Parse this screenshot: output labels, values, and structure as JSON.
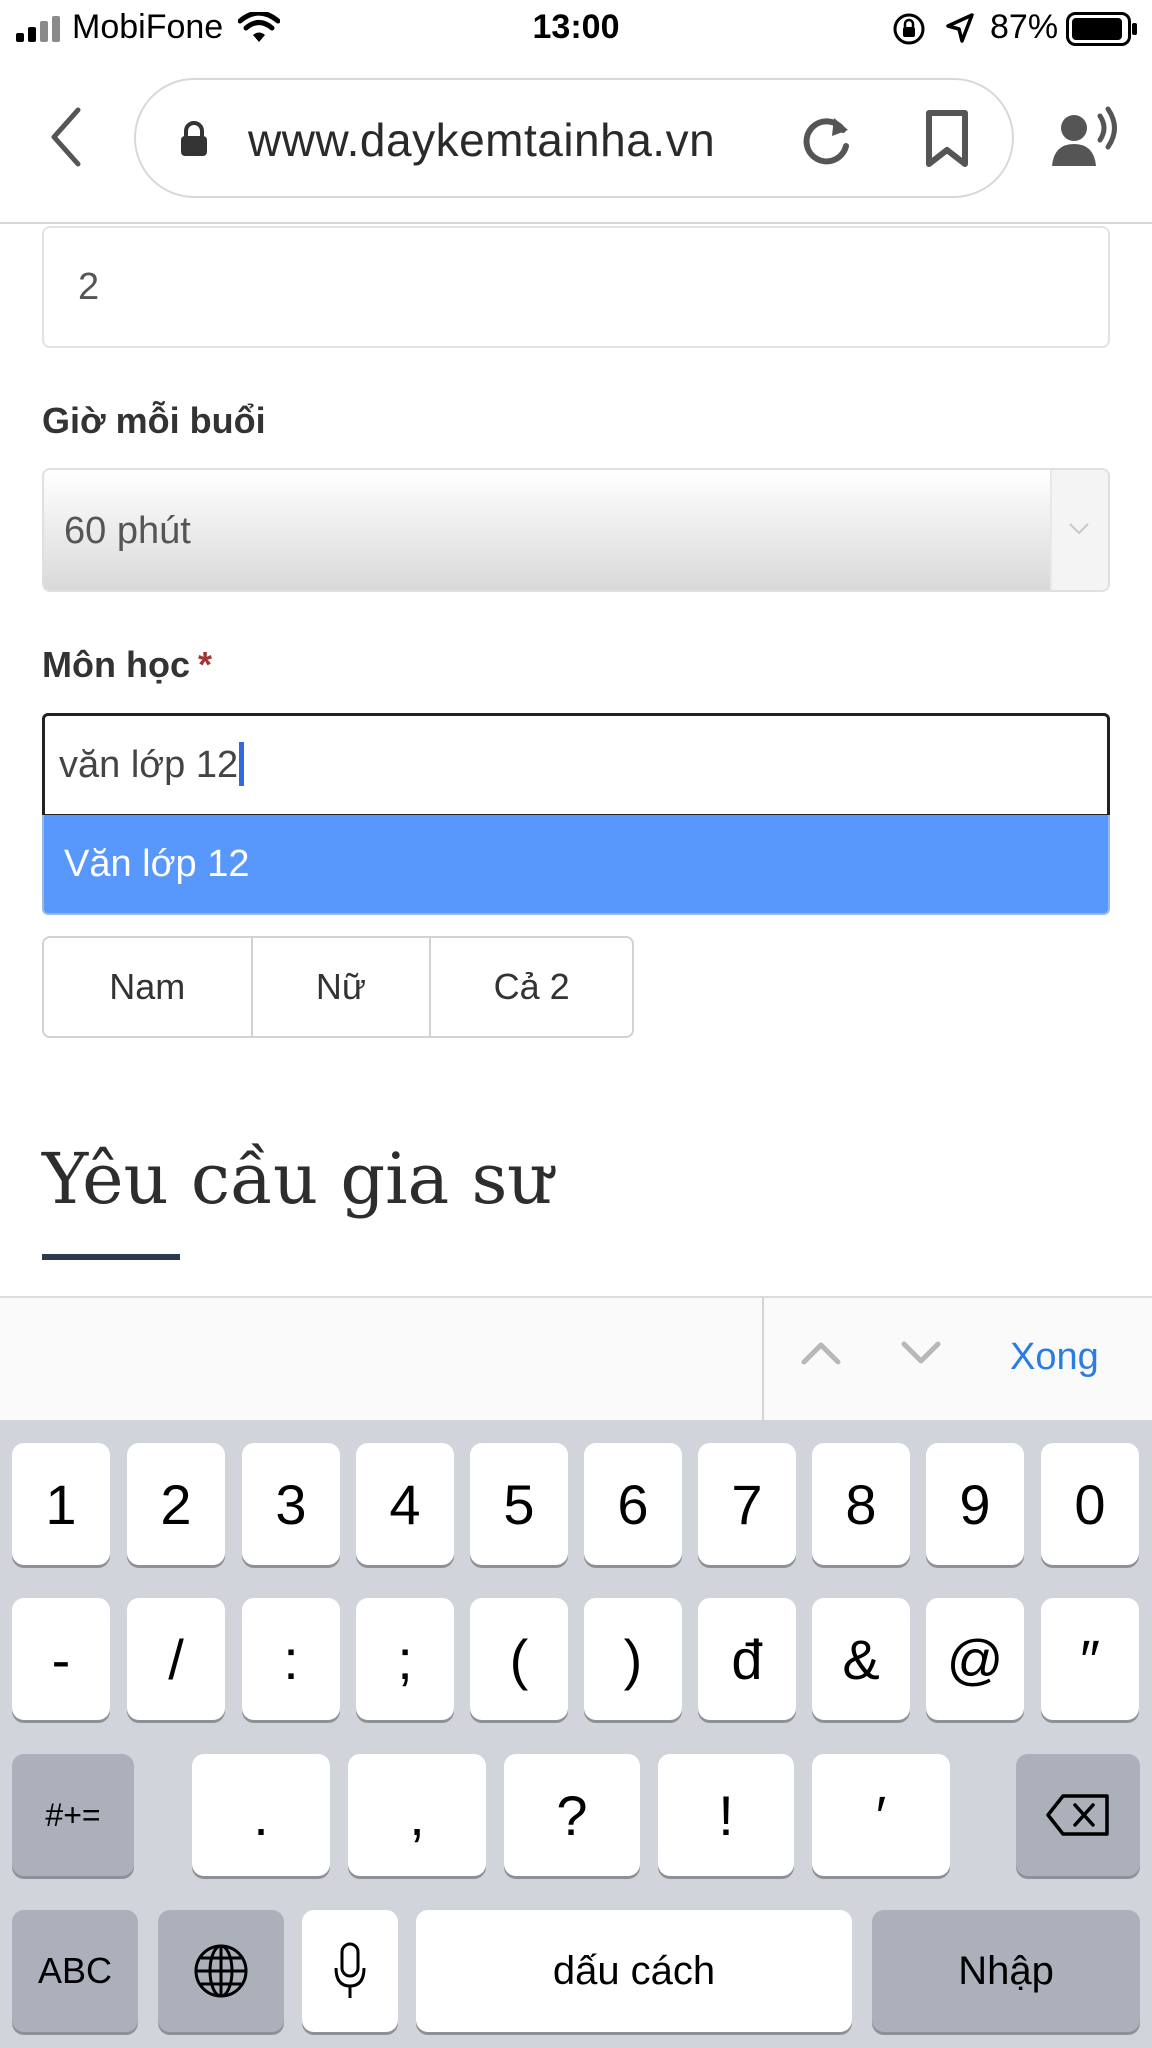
{
  "status_bar": {
    "carrier": "MobiFone",
    "time": "13:00",
    "battery_percent": "87%",
    "icons": [
      "signal-icon",
      "wifi-icon",
      "orientation-lock-icon",
      "location-icon",
      "battery-icon"
    ]
  },
  "browser": {
    "url": "www.daykemtainha.vn",
    "icons": [
      "back-icon",
      "lock-icon",
      "reload-icon",
      "bookmark-icon",
      "reader-voice-icon"
    ]
  },
  "form": {
    "sessions_value": "2",
    "hours_label": "Giờ mỗi buổi",
    "hours_value": "60 phút",
    "subject_label": "Môn học",
    "subject_required_mark": "*",
    "subject_value": "văn lớp 12",
    "subject_suggestion": "Văn lớp 12",
    "gender_options": [
      "Nam",
      "Nữ",
      "Cả 2"
    ]
  },
  "section": {
    "title": "Yêu cầu gia sư"
  },
  "accessory_bar": {
    "done_label": "Xong"
  },
  "keyboard": {
    "row1": [
      "1",
      "2",
      "3",
      "4",
      "5",
      "6",
      "7",
      "8",
      "9",
      "0"
    ],
    "row2": [
      "-",
      "/",
      ":",
      ";",
      "(",
      ")",
      "đ",
      "&",
      "@",
      "″"
    ],
    "row3_left": "#+=",
    "row3_mid": [
      ".",
      ",",
      "?",
      "!",
      "′"
    ],
    "row4_abc": "ABC",
    "row4_space": "dấu cách",
    "row4_return": "Nhập"
  },
  "colors": {
    "suggestion_bg": "#5897fb",
    "accent_blue": "#2a7de1",
    "required_star": "#a0362f",
    "keyboard_bg": "#d1d4da"
  }
}
